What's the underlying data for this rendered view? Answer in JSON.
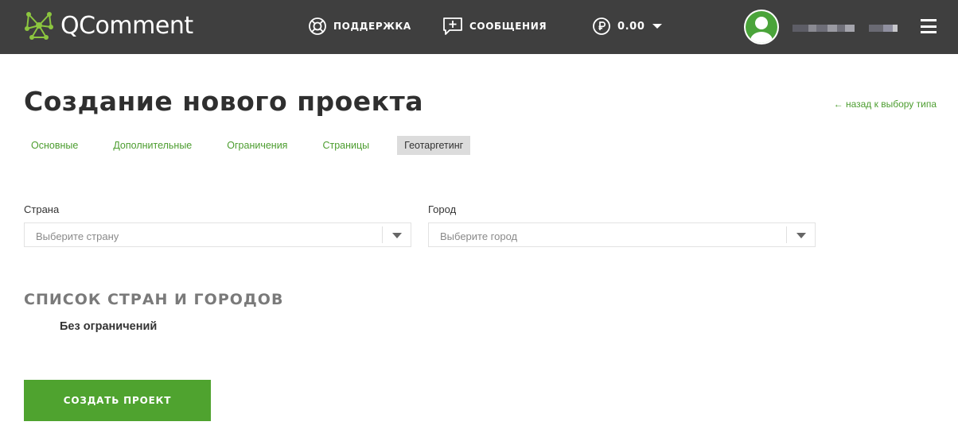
{
  "app": {
    "logo_text": "QComment"
  },
  "header": {
    "support_label": "ПОДДЕРЖКА",
    "messages_label": "СООБЩЕНИЯ",
    "balance": "0.00"
  },
  "page": {
    "title": "Создание нового проекта",
    "back_link": "← назад к выбору типа"
  },
  "tabs": [
    {
      "label": "Основные",
      "active": false
    },
    {
      "label": "Дополнительные",
      "active": false
    },
    {
      "label": "Ограничения",
      "active": false
    },
    {
      "label": "Страницы",
      "active": false
    },
    {
      "label": "Геотаргетинг",
      "active": true
    }
  ],
  "form": {
    "country_label": "Страна",
    "country_placeholder": "Выберите страну",
    "city_label": "Город",
    "city_placeholder": "Выберите город"
  },
  "list": {
    "title": "СПИСОК СТРАН И ГОРОДОВ",
    "empty_text": "Без ограничений"
  },
  "actions": {
    "create_label": "СОЗДАТЬ ПРОЕКТ"
  },
  "colors": {
    "header_bg": "#3f3f3f",
    "accent_green": "#4fa32f",
    "link_green": "#4c9d2f",
    "active_tab_bg": "#dcdcdc"
  },
  "icons": {
    "logo": "network-logo-icon",
    "support": "lifebuoy-icon",
    "messages": "message-plus-icon",
    "currency": "ruble-icon",
    "balance_dropdown": "chevron-down-icon",
    "avatar": "user-avatar-icon",
    "menu": "hamburger-menu-icon"
  }
}
